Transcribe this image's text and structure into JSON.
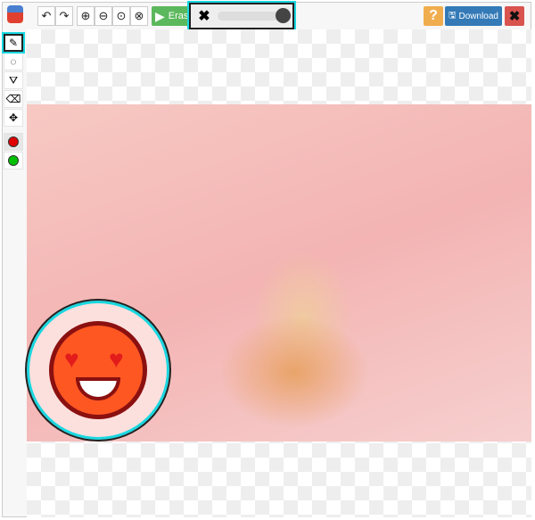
{
  "toolbar": {
    "undo_icon": "undo-icon",
    "redo_icon": "redo-icon",
    "zoom_in_icon": "zoom-in-icon",
    "zoom_out_icon": "zoom-out-icon",
    "zoom_reset_icon": "zoom-1to1-icon",
    "zoom_fit_icon": "zoom-fit-icon",
    "erase_label": "Erase",
    "brush_size_percent": 100,
    "help_label": "?",
    "download_label": "Download"
  },
  "sidebar": {
    "tools": [
      "brush",
      "lasso",
      "polygon",
      "eraser",
      "move"
    ],
    "colors": [
      "#e00000",
      "#00c000"
    ]
  },
  "colors": {
    "accent": "#19d7e0",
    "erase": "#5cb85c",
    "download": "#337ab7",
    "help": "#f0ad4e",
    "close": "#d9534f"
  }
}
